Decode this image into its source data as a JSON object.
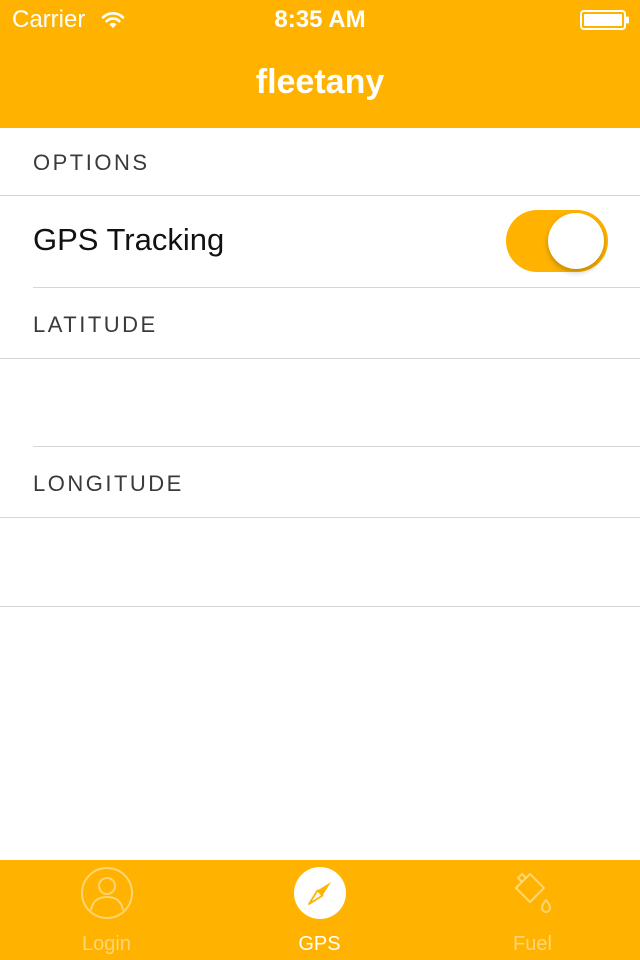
{
  "status_bar": {
    "carrier": "Carrier",
    "time": "8:35 AM",
    "wifi_icon": "wifi-icon",
    "battery_icon": "battery-icon"
  },
  "nav": {
    "title": "fleetany"
  },
  "sections": {
    "options_header": "OPTIONS",
    "gps_tracking_label": "GPS Tracking",
    "gps_tracking_on": true,
    "latitude_header": "LATITUDE",
    "latitude_value": "",
    "longitude_header": "LONGITUDE",
    "longitude_value": ""
  },
  "tabs": [
    {
      "label": "Login",
      "icon": "person-icon",
      "active": false
    },
    {
      "label": "GPS",
      "icon": "compass-icon",
      "active": true
    },
    {
      "label": "Fuel",
      "icon": "fuel-can-icon",
      "active": false
    }
  ],
  "colors": {
    "accent": "#FFB300",
    "background": "#FFFFFF",
    "separator": "#D6D6D6"
  }
}
